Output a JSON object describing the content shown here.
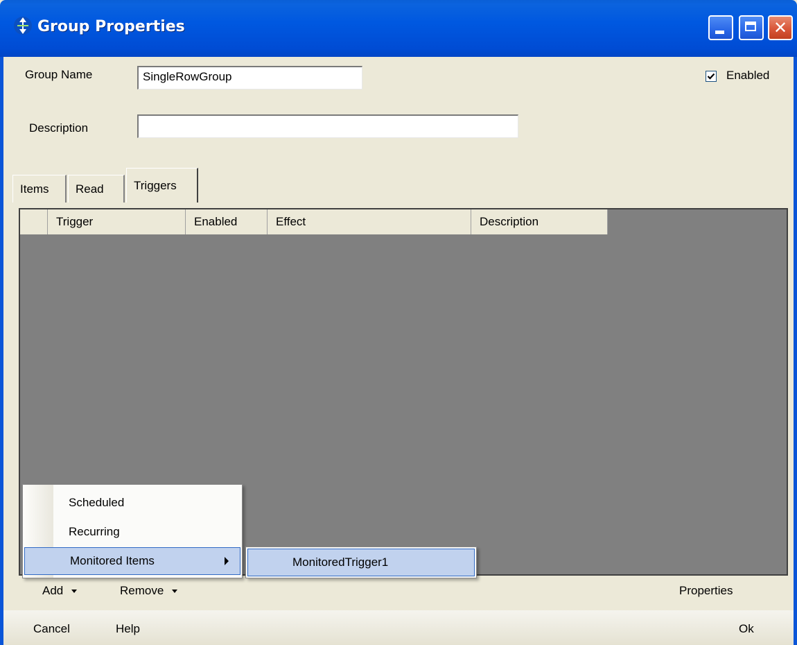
{
  "window": {
    "title": "Group Properties"
  },
  "form": {
    "group_name_label": "Group Name",
    "group_name_value": "SingleRowGroup",
    "description_label": "Description",
    "description_value": "",
    "enabled_label": "Enabled",
    "enabled_checked": true
  },
  "tabs": [
    {
      "label": "Items",
      "active": false
    },
    {
      "label": "Read",
      "active": false
    },
    {
      "label": "Triggers",
      "active": true
    }
  ],
  "grid": {
    "columns": [
      "Trigger",
      "Enabled",
      "Effect",
      "Description"
    ]
  },
  "toolbar": {
    "add": "Add",
    "remove": "Remove",
    "properties": "Properties"
  },
  "add_menu": {
    "items": [
      "Scheduled",
      "Recurring",
      "Monitored Items"
    ],
    "highlighted": "Monitored Items"
  },
  "submenu": {
    "items": [
      "MonitoredTrigger1"
    ]
  },
  "bottom": {
    "cancel": "Cancel",
    "help": "Help",
    "ok": "Ok"
  },
  "colors": {
    "titlebar": "#0058E0",
    "grid_bg": "#808080",
    "menu_highlight": "#C1D2EE",
    "window_bg": "#ECE9D8"
  }
}
